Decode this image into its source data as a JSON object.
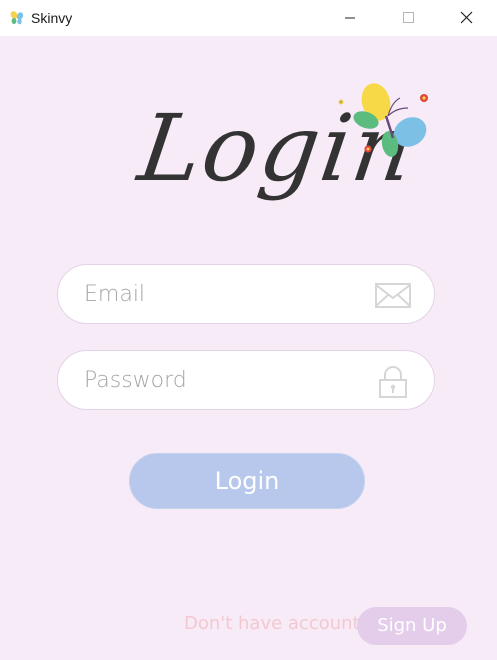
{
  "window": {
    "title": "Skinvy",
    "controls": [
      "minimize",
      "maximize",
      "close"
    ]
  },
  "header": {
    "title": "Login"
  },
  "form": {
    "email": {
      "placeholder": "Email",
      "value": "",
      "icon": "envelope-icon"
    },
    "password": {
      "placeholder": "Password",
      "value": "",
      "icon": "lock-icon"
    },
    "login_label": "Login"
  },
  "footer": {
    "prompt": "Don't have account?",
    "signup_label": "Sign Up"
  },
  "colors": {
    "background": "#f7ebf7",
    "login_button": "#b8c8ec",
    "signup_button": "#e3cdea",
    "prompt_text": "#f4c8cf"
  }
}
